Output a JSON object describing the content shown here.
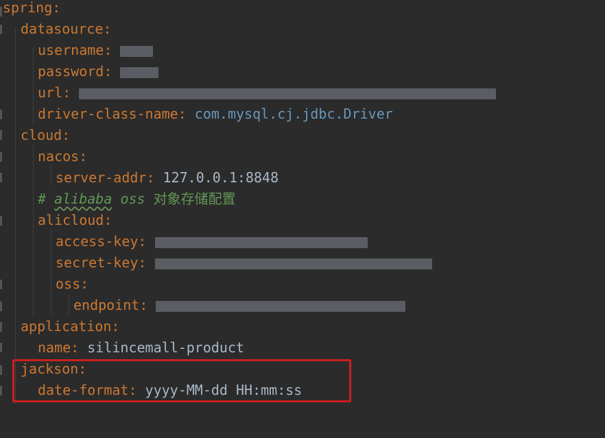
{
  "lines": {
    "spring": {
      "key": "spring",
      "colon": ":"
    },
    "datasource": {
      "key": "datasource",
      "colon": ":"
    },
    "username": {
      "key": "username",
      "colon": ":"
    },
    "password": {
      "key": "password",
      "colon": ":"
    },
    "url": {
      "key": "url",
      "colon": ":"
    },
    "driver": {
      "key": "driver-class-name",
      "colon": ":",
      "value": "com.mysql.cj.jdbc.Driver"
    },
    "cloud": {
      "key": "cloud",
      "colon": ":"
    },
    "nacos": {
      "key": "nacos",
      "colon": ":"
    },
    "server_addr": {
      "key": "server-addr",
      "colon": ":",
      "value": "127.0.0.1:8848"
    },
    "comment": {
      "hash": "#",
      "word1": "alibaba",
      "word2": "oss",
      "cn": "对象存储配置"
    },
    "alicloud": {
      "key": "alicloud",
      "colon": ":"
    },
    "access_key": {
      "key": "access-key",
      "colon": ":"
    },
    "secret_key": {
      "key": "secret-key",
      "colon": ":"
    },
    "oss": {
      "key": "oss",
      "colon": ":"
    },
    "endpoint": {
      "key": "endpoint",
      "colon": ":"
    },
    "application": {
      "key": "application",
      "colon": ":"
    },
    "name": {
      "key": "name",
      "colon": ":",
      "value": "silincemall-product"
    },
    "jackson": {
      "key": "jackson",
      "colon": ":"
    },
    "date_format": {
      "key": "date-format",
      "colon": ":",
      "value": "yyyy-MM-dd HH:mm:ss"
    }
  },
  "colors": {
    "background": "#2b2b2b",
    "key": "#cc7832",
    "comment": "#629755",
    "highlight_border": "#cc1f1f",
    "redaction": "#5a5d63"
  }
}
